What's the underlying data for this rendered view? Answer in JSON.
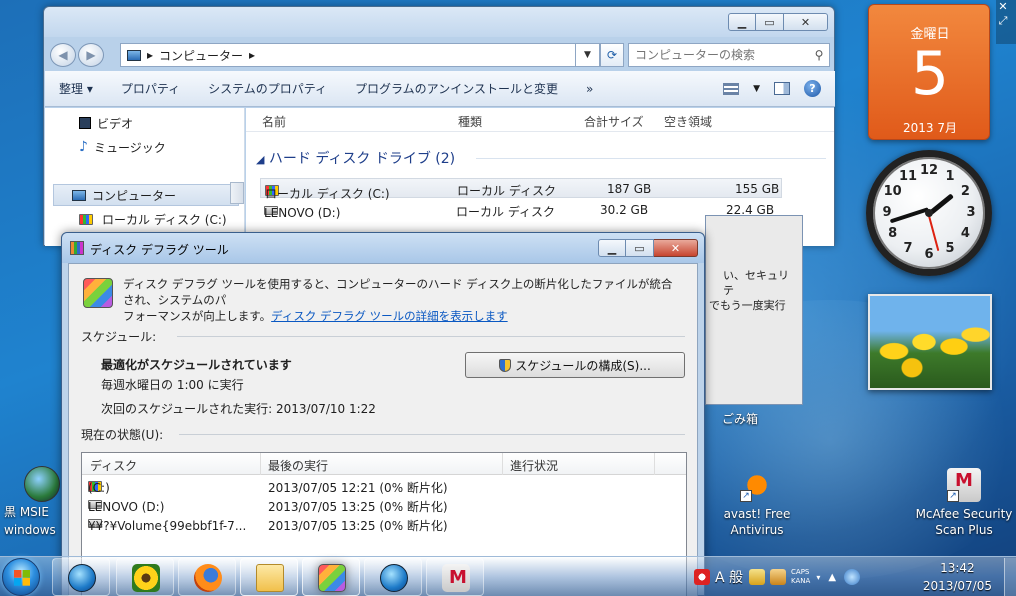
{
  "explorer": {
    "breadcrumb": [
      "コンピューター"
    ],
    "search_placeholder": "コンピューターの検索",
    "commands": [
      "整理 ▾",
      "プロパティ",
      "システムのプロパティ",
      "プログラムのアンインストールと変更",
      "»"
    ],
    "nav_items": [
      {
        "label": "ビデオ",
        "icon": "video-icon"
      },
      {
        "label": "ミュージック",
        "icon": "music-icon"
      },
      {
        "label": "コンピューター",
        "icon": "computer-icon",
        "selected": true
      },
      {
        "label": "ローカル ディスク (C:)",
        "icon": "drive-icon"
      }
    ],
    "columns": [
      "名前",
      "種類",
      "合計サイズ",
      "空き領域"
    ],
    "group_label": "ハード ディスク ドライブ (2)",
    "drives": [
      {
        "name": "ローカル ディスク (C:)",
        "type": "ローカル ディスク",
        "total": "187 GB",
        "free": "155 GB",
        "selected": true
      },
      {
        "name": "LENOVO (D:)",
        "type": "ローカル ディスク",
        "total": "30.2 GB",
        "free": "22.4 GB"
      }
    ]
  },
  "defrag": {
    "title": "ディスク デフラグ ツール",
    "desc_line1": "ディスク デフラグ ツールを使用すると、コンピューターのハード ディスク上の断片化したファイルが統合され、システムのパ",
    "desc_line2": "フォーマンスが向上します。",
    "desc_link": "ディスク デフラグ ツールの詳細を表示します",
    "schedule_header": "スケジュール:",
    "schedule_status": "最適化がスケジュールされています",
    "schedule_freq": "毎週水曜日の 1:00 に実行",
    "schedule_next": "次回のスケジュールされた実行: 2013/07/10 1:22",
    "schedule_button": "スケジュールの構成(S)...",
    "current_header": "現在の状態(U):",
    "list_columns": [
      "ディスク",
      "最後の実行",
      "進行状況"
    ],
    "disks": [
      {
        "disk": "(C:)",
        "last_run": "2013/07/05 12:21 (0% 断片化)",
        "progress": "",
        "system": true
      },
      {
        "disk": "LENOVO (D:)",
        "last_run": "2013/07/05 13:25 (0% 断片化)",
        "progress": ""
      },
      {
        "disk": "¥¥?¥Volume{99ebbf1f-7...",
        "last_run": "2013/07/05 13:25 (0% 断片化)",
        "progress": ""
      }
    ]
  },
  "behind_dialog": {
    "text_line1": "い、セキュリテ",
    "text_line2": "でもう一度実行"
  },
  "desktop": {
    "recycle_bin": "ごみ箱",
    "icons": [
      {
        "label_line1": "avast! Free",
        "label_line2": "Antivirus",
        "icon": "avast-icon"
      },
      {
        "label_line1": "McAfee Security",
        "label_line2": "Scan Plus",
        "icon": "mcafee-icon"
      }
    ],
    "left_label_line1": "黒   MSIE",
    "left_label_line2": "windows"
  },
  "gadgets": {
    "calendar": {
      "weekday": "金曜日",
      "day": "5",
      "year_month": "2013 7月"
    },
    "clock": {
      "numbers": [
        "12",
        "1",
        "2",
        "3",
        "4",
        "5",
        "6",
        "7",
        "8",
        "9",
        "10",
        "11"
      ],
      "hour": 1,
      "minute": 42
    }
  },
  "taskbar": {
    "ime_mode": "A 般",
    "caps": "CAPS",
    "kana": "KANA",
    "time": "13:42",
    "date": "2013/07/05"
  },
  "colors": {
    "accent": "#1e3e8a",
    "link": "#0a58c2",
    "close_red": "#c7452f",
    "calendar_orange": "#e05a1a"
  }
}
